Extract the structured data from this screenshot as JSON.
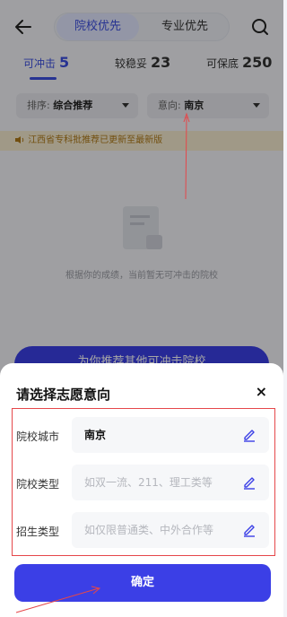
{
  "header": {
    "tabs": [
      "院校优先",
      "专业优先"
    ]
  },
  "categories": [
    {
      "label": "可冲击",
      "count": "5"
    },
    {
      "label": "较稳妥",
      "count": "23"
    },
    {
      "label": "可保底",
      "count": "250"
    }
  ],
  "filters": {
    "sort_prefix": "排序:",
    "sort_value": "综合推荐",
    "intent_prefix": "意向:",
    "intent_value": "南京"
  },
  "notice": "江西省专科批推荐已更新至最新版",
  "empty_text": "根据你的成绩，当前暂无可冲击的院校",
  "recommend_button": "为你推荐其他可冲击院校",
  "sheet": {
    "title": "请选择志愿意向",
    "close": "×",
    "rows": [
      {
        "label": "院校城市",
        "value": "南京",
        "placeholder": ""
      },
      {
        "label": "院校类型",
        "value": "",
        "placeholder": "如双一流、211、理工类等"
      },
      {
        "label": "招生类型",
        "value": "",
        "placeholder": "如仅限普通类、中外合作等"
      }
    ],
    "confirm": "确定"
  },
  "colors": {
    "accent": "#3b3fe6",
    "annotation": "#e5474a"
  }
}
